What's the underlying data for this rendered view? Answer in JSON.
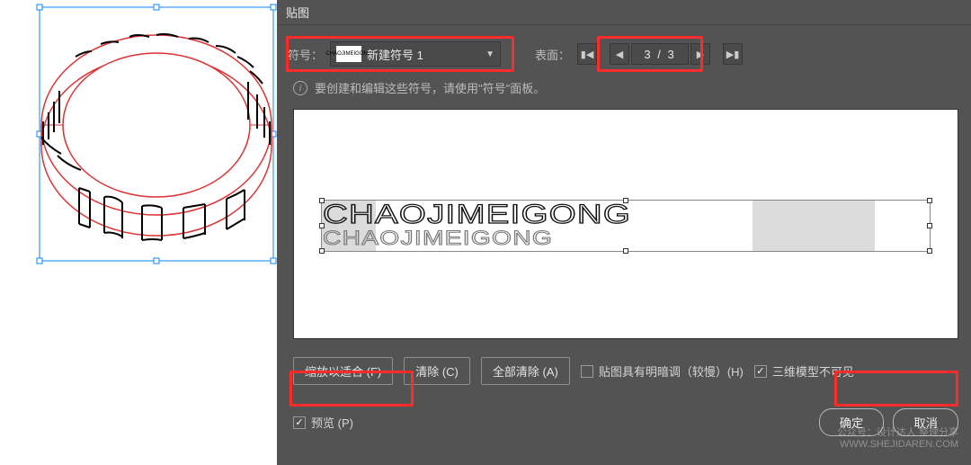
{
  "dialog": {
    "title": "贴图",
    "symbol": {
      "label": "符号：",
      "selected_name": "新建符号 1",
      "thumb_text": "CHAOJIMEIGONG"
    },
    "surface": {
      "label": "表面：",
      "page_text": "3 / 3"
    },
    "info_text": "要创建和编辑这些符号，请使用\"符号\"面板。",
    "preview": {
      "art_text": "CHAOJIMEIGONG",
      "shadow_text": "CHAOJIMEIGONG"
    },
    "buttons": {
      "scale_fit": "缩放以适合 (F)",
      "clear": "清除 (C)",
      "clear_all": "全部清除 (A)"
    },
    "checkboxes": {
      "shading": {
        "label": "贴图具有明暗调（较慢）(H)",
        "checked": false
      },
      "invisible_geo": {
        "label": "三维模型不可见",
        "checked": true
      },
      "preview": {
        "label": "预览 (P)",
        "checked": true
      }
    },
    "footer": {
      "ok": "确定",
      "cancel": "取消"
    }
  },
  "watermark": {
    "line1": "公众号：设计达人 整理分享",
    "line2": "WWW.SHEJIDAREN.COM"
  }
}
